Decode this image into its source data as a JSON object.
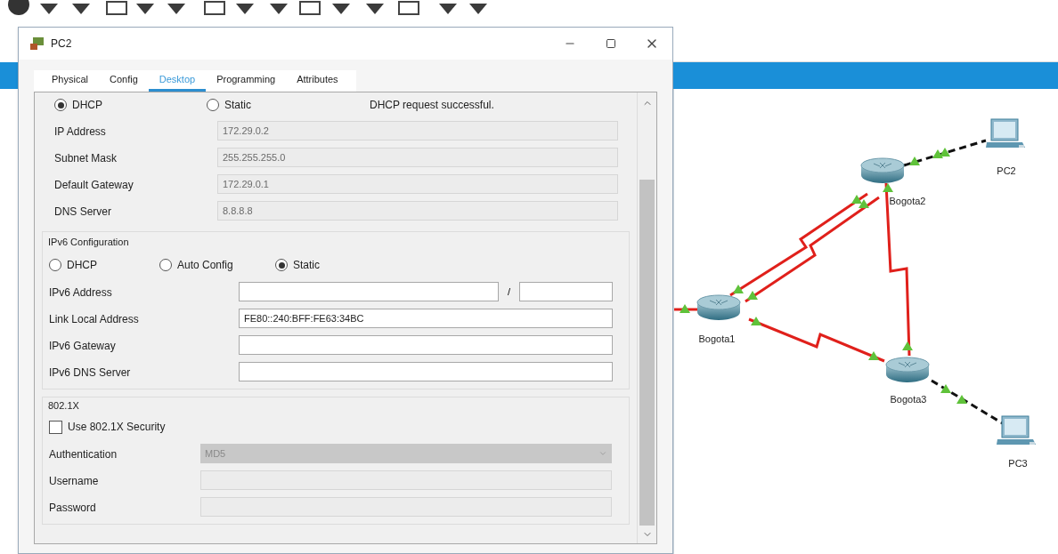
{
  "window": {
    "title": "PC2"
  },
  "tabs": [
    {
      "label": "Physical",
      "selected": false
    },
    {
      "label": "Config",
      "selected": false
    },
    {
      "label": "Desktop",
      "selected": true
    },
    {
      "label": "Programming",
      "selected": false
    },
    {
      "label": "Attributes",
      "selected": false
    }
  ],
  "ipv4": {
    "mode_options": [
      {
        "label": "DHCP",
        "selected": true
      },
      {
        "label": "Static",
        "selected": false
      }
    ],
    "status": "DHCP request successful.",
    "fields": [
      {
        "label": "IP Address",
        "value": "172.29.0.2",
        "disabled": true
      },
      {
        "label": "Subnet Mask",
        "value": "255.255.255.0",
        "disabled": true
      },
      {
        "label": "Default Gateway",
        "value": "172.29.0.1",
        "disabled": true
      },
      {
        "label": "DNS Server",
        "value": "8.8.8.8",
        "disabled": true
      }
    ]
  },
  "ipv6": {
    "title": "IPv6 Configuration",
    "mode_options": [
      {
        "label": "DHCP",
        "selected": false
      },
      {
        "label": "Auto Config",
        "selected": false
      },
      {
        "label": "Static",
        "selected": true
      }
    ],
    "fields": [
      {
        "label": "IPv6 Address",
        "kind": "address_prefix",
        "separator": "/",
        "disabled": false
      },
      {
        "label": "Link Local Address",
        "kind": "text",
        "value": "FE80::240:BFF:FE63:34BC",
        "disabled": false
      },
      {
        "label": "IPv6 Gateway",
        "kind": "text",
        "disabled": false
      },
      {
        "label": "IPv6 DNS Server",
        "kind": "text",
        "disabled": false
      }
    ]
  },
  "dot1x": {
    "title": "802.1X",
    "checkbox": {
      "label": "Use 802.1X Security",
      "checked": false
    },
    "fields": [
      {
        "label": "Authentication",
        "kind": "select",
        "value": "MD5",
        "disabled": true
      },
      {
        "label": "Username",
        "kind": "text",
        "disabled": true
      },
      {
        "label": "Password",
        "kind": "text",
        "disabled": true
      }
    ]
  },
  "topology": {
    "nodes": [
      {
        "kind": "router",
        "label": "Bogota2"
      },
      {
        "kind": "laptop",
        "label": "PC2"
      },
      {
        "kind": "router",
        "label": "Bogota1"
      },
      {
        "kind": "router",
        "label": "Bogota3"
      },
      {
        "kind": "laptop",
        "label": "PC3"
      }
    ],
    "links": [
      {
        "kind": "serial"
      },
      {
        "kind": "serial"
      },
      {
        "kind": "serial"
      },
      {
        "kind": "serial"
      },
      {
        "kind": "serial"
      },
      {
        "kind": "ethernet"
      },
      {
        "kind": "ethernet"
      }
    ]
  }
}
